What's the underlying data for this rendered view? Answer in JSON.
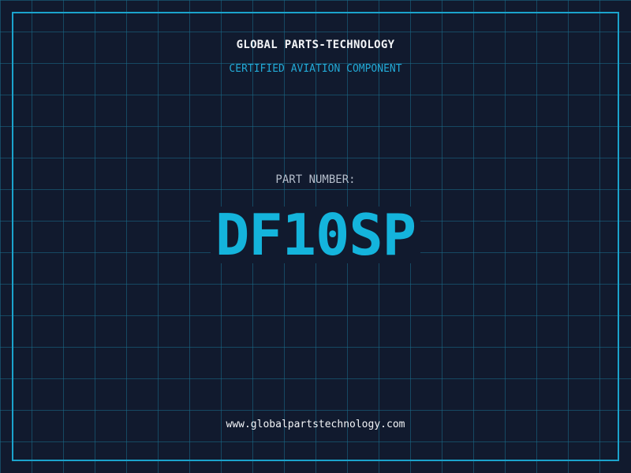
{
  "header": {
    "company": "GLOBAL PARTS-TECHNOLOGY",
    "tagline": "CERTIFIED AVIATION COMPONENT"
  },
  "part": {
    "label": "PART NUMBER:",
    "number": "DF10SP"
  },
  "footer": {
    "url": "www.globalpartstechnology.com"
  },
  "colors": {
    "background": "#111a2e",
    "accent": "#14b4dc",
    "border": "#1ba3cc"
  }
}
